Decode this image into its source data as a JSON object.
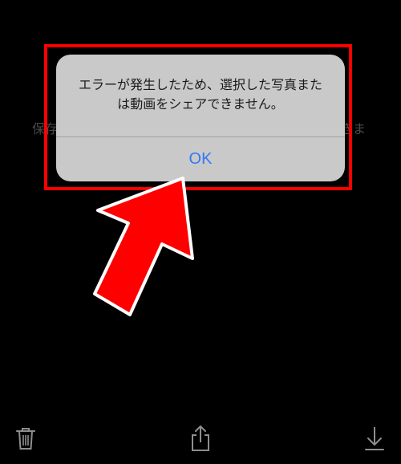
{
  "background": {
    "left_text": "保存",
    "right_text": "きま"
  },
  "alert": {
    "message_line1": "エラーが発生したため、選択した写真また",
    "message_line2": "は動画をシェアできません。",
    "ok_label": "OK"
  },
  "colors": {
    "background": "#000000",
    "alert_bg": "#c9c9c9",
    "accent_blue": "#3478f6",
    "highlight_red": "#ff0000",
    "icon_gray": "#8e8e8e"
  },
  "toolbar": {
    "icons": [
      "trash-icon",
      "share-icon",
      "download-icon"
    ]
  }
}
